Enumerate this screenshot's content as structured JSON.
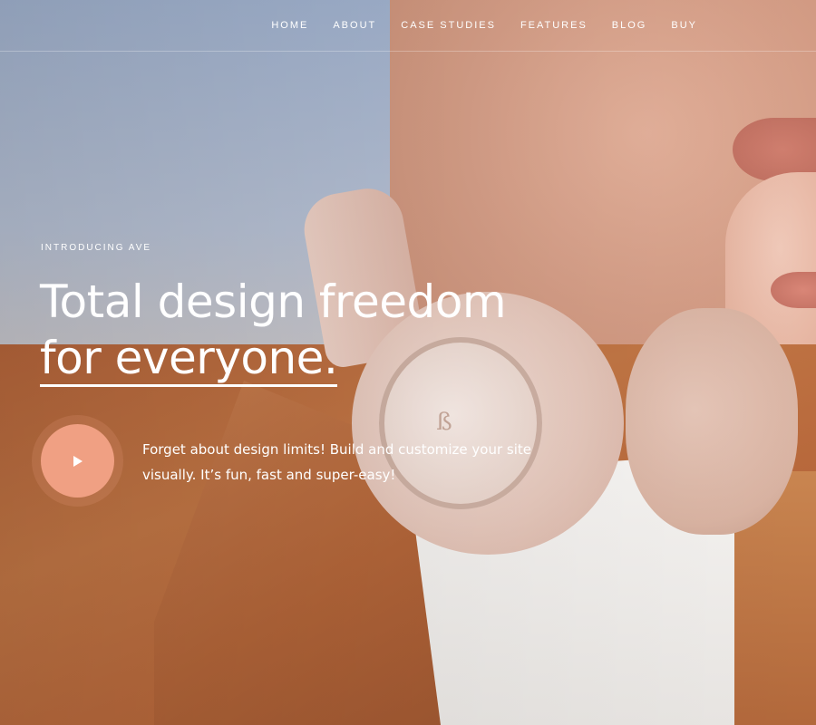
{
  "nav": {
    "items": [
      {
        "label": "HOME"
      },
      {
        "label": "ABOUT"
      },
      {
        "label": "CASE STUDIES"
      },
      {
        "label": "FEATURES"
      },
      {
        "label": "BLOG"
      },
      {
        "label": "BUY"
      }
    ]
  },
  "hero": {
    "eyebrow": "INTRODUCING AVE",
    "headline_line1": "Total design freedom",
    "headline_line2": "for everyone.",
    "description": "Forget about design limits! Build and customize your site visually. It’s fun, fast and super-easy!",
    "play_icon": "play-icon",
    "brand_logo": "ß"
  },
  "colors": {
    "accent": "#f0a083",
    "text": "#ffffff"
  }
}
